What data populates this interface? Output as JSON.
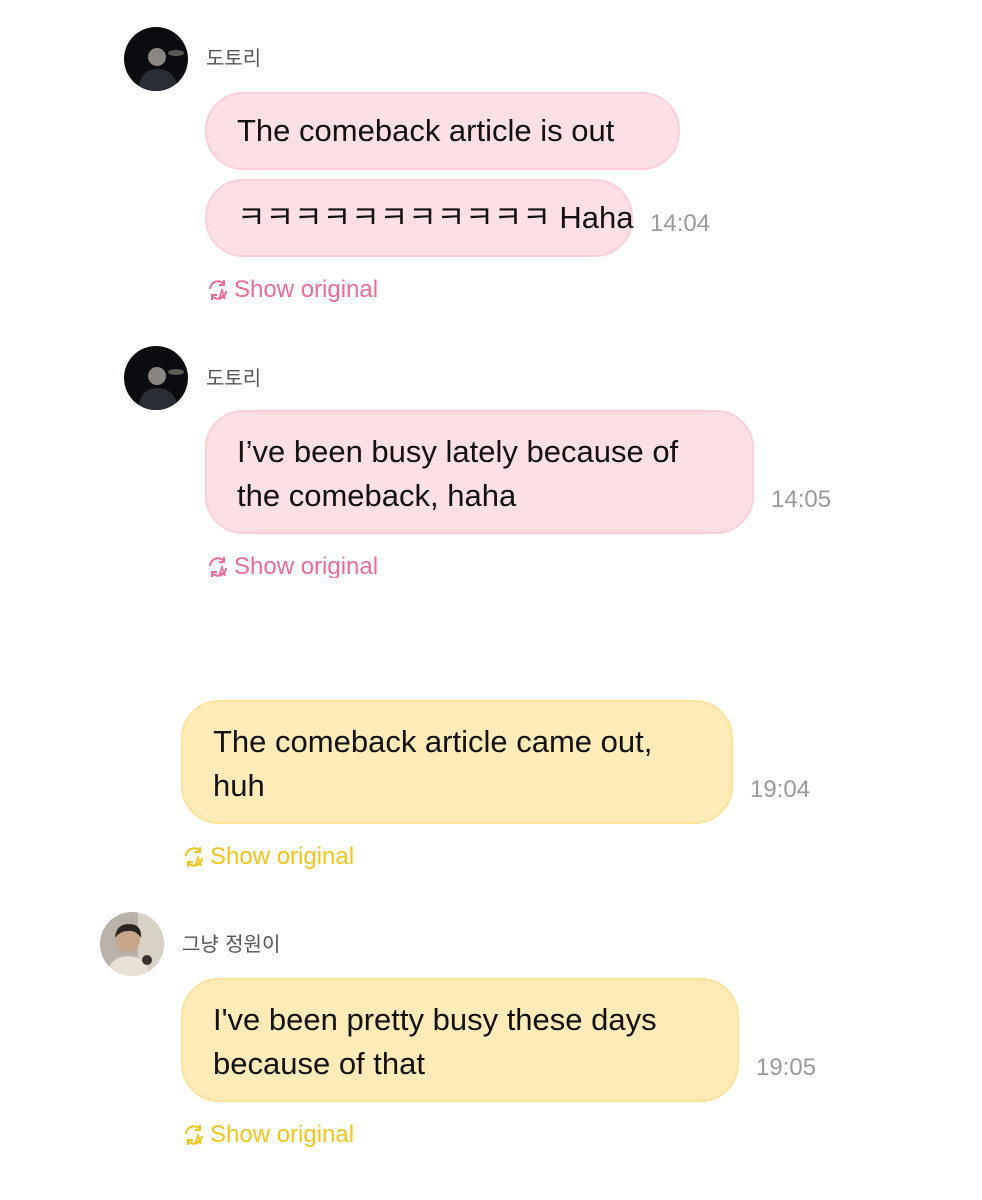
{
  "colors": {
    "pink_bubble": "#fde0e5",
    "yellow_bubble": "#feebb8",
    "pink_link": "#ee6b93",
    "yellow_link": "#f3c51a",
    "timestamp": "#9a9a9a"
  },
  "groups": [
    {
      "sender": "도토리",
      "avatar": "dark-photo-avatar",
      "messages": [
        {
          "text": "The comeback article is out",
          "time": ""
        },
        {
          "text": "ㅋㅋㅋㅋㅋㅋㅋㅋㅋㅋㅋ Haha",
          "time": "14:04"
        }
      ],
      "show_original": "Show original"
    },
    {
      "sender": "도토리",
      "avatar": "dark-photo-avatar",
      "messages": [
        {
          "text": "I’ve been busy lately because of the comeback, haha",
          "time": "14:05"
        }
      ],
      "show_original": "Show original"
    },
    {
      "sender": "",
      "avatar": "",
      "messages": [
        {
          "text": "The comeback article came out, huh",
          "time": "19:04"
        }
      ],
      "show_original": "Show original"
    },
    {
      "sender": "그냥 정원이",
      "avatar": "light-photo-avatar",
      "messages": [
        {
          "text": "I've been pretty busy these days because of that",
          "time": "19:05"
        }
      ],
      "show_original": "Show original"
    }
  ]
}
